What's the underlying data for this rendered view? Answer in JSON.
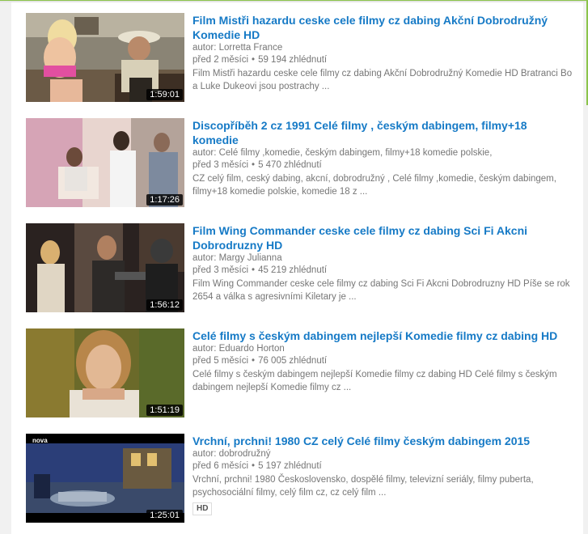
{
  "videos": [
    {
      "title": "Film Mistři hazardu ceske cele filmy cz dabing Akční Dobrodružný Komedie HD",
      "author": "autor: Lorretta France",
      "age": "před 2 měsíci",
      "views": "59 194 zhlédnutí",
      "description": "Film Mistři hazardu ceske cele filmy cz dabing Akční Dobrodružný Komedie HD Bratranci Bo a Luke Dukeovi jsou postrachy ...",
      "duration": "1:59:01"
    },
    {
      "title": "Discopříběh 2 cz 1991 Celé filmy , českým dabingem, filmy+18 komedie",
      "author": "autor: Celé filmy ,komedie, českým dabingem, filmy+18 komedie polskie,",
      "age": "před 3 měsíci",
      "views": "5 470 zhlédnutí",
      "description": "CZ celý film, ceský dabing, akcní, dobrodružný , Celé filmy ,komedie, českým dabingem, filmy+18 komedie polskie, komedie 18 z ...",
      "duration": "1:17:26"
    },
    {
      "title": "Film Wing Commander ceske cele filmy cz dabing Sci Fi Akcni Dobrodruzny HD",
      "author": "autor: Margy Julianna",
      "age": "před 3 měsíci",
      "views": "45 219 zhlédnutí",
      "description": "Film Wing Commander ceske cele filmy cz dabing Sci Fi Akcni Dobrodruzny HD Píše se rok 2654 a válka s agresivními Kiletary je ...",
      "duration": "1:56:12"
    },
    {
      "title": "Celé filmy s českým dabingem nejlepší Komedie filmy cz dabing HD",
      "author": "autor: Eduardo Horton",
      "age": "před 5 měsíci",
      "views": "76 005 zhlédnutí",
      "description": "Celé filmy s českým dabingem nejlepší Komedie filmy cz dabing HD Celé filmy s českým dabingem nejlepší Komedie filmy cz ...",
      "duration": "1:51:19"
    },
    {
      "title": "Vrchní, prchni! 1980 CZ celý Celé filmy českým dabingem 2015",
      "author": "autor: dobrodružný",
      "age": "před 6 měsíci",
      "views": "5 197 zhlédnutí",
      "description": "Vrchní, prchni! 1980 Československo, dospělé filmy, televizní seriály, filmy puberta, psychosociální filmy, celý film cz, cz celý film ...",
      "duration": "1:25:01",
      "badge": "HD",
      "thumb_logo": "nova"
    }
  ]
}
